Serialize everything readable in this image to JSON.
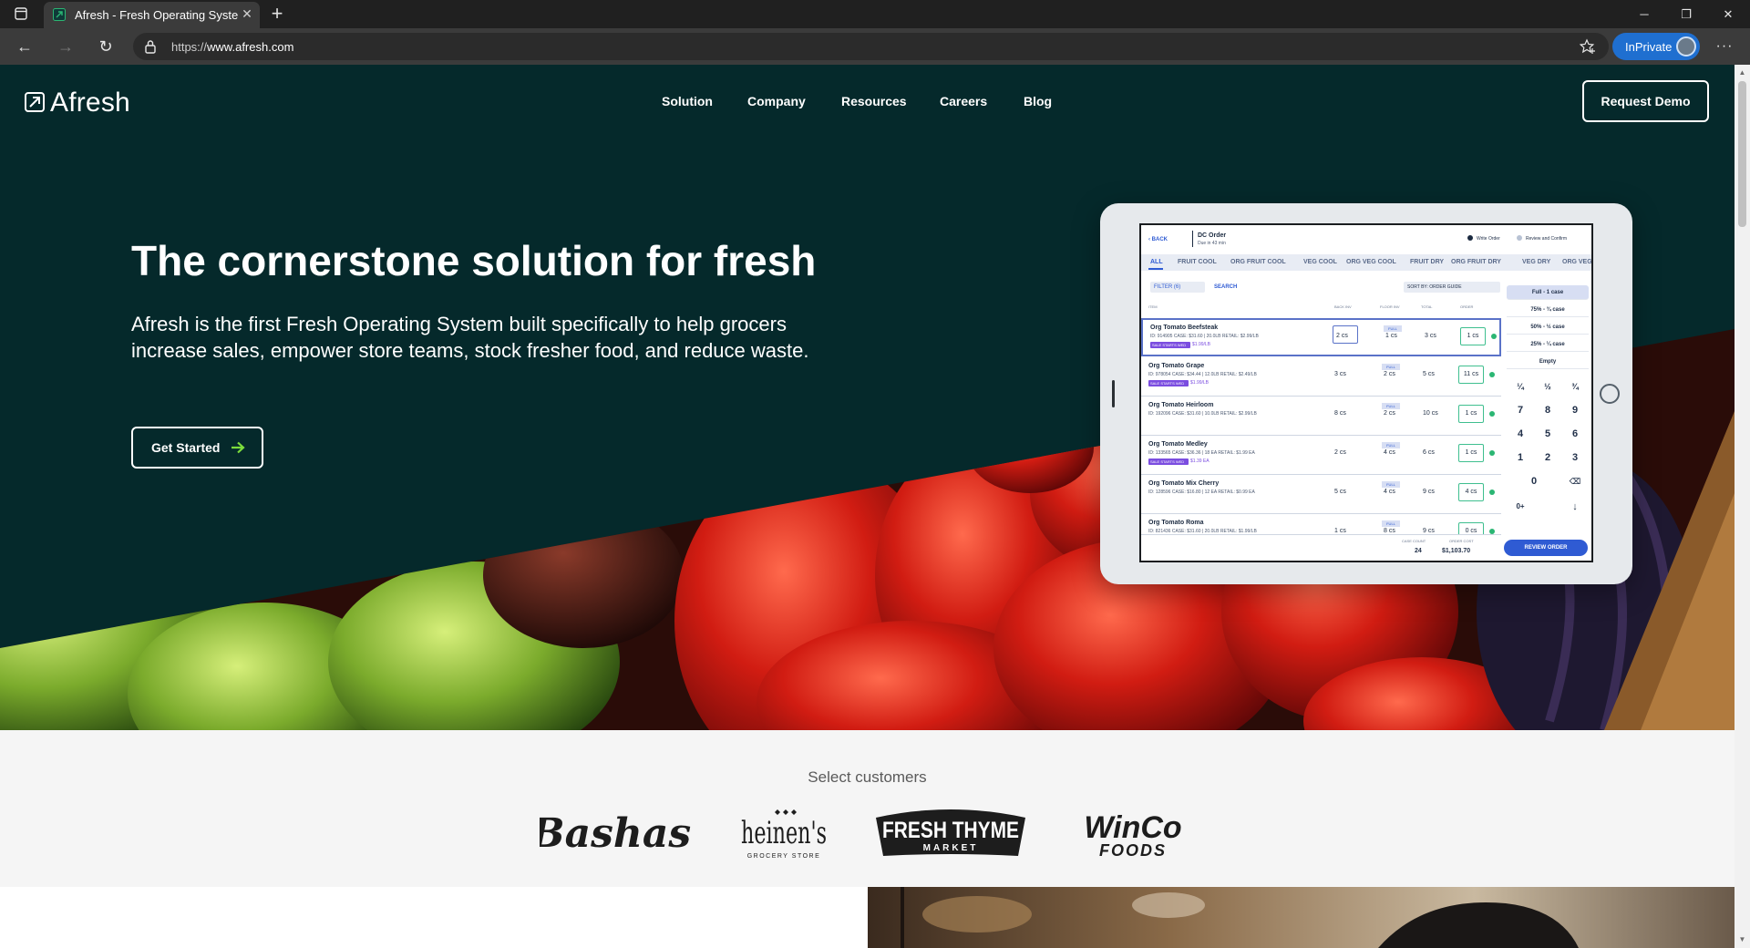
{
  "browser": {
    "tab_title": "Afresh - Fresh Operating System",
    "tab_close": "✕",
    "new_tab": "+",
    "url_scheme": "https://",
    "url_host": "www.afresh.com",
    "inprivate_label": "InPrivate",
    "menu_glyph": "···",
    "minimize": "─",
    "restore": "❐",
    "close": "✕",
    "back": "←",
    "forward": "→",
    "reload": "↻"
  },
  "site": {
    "logo_text": "Afresh",
    "nav": [
      "Solution",
      "Company",
      "Resources",
      "Careers",
      "Blog"
    ],
    "cta_label": "Request Demo"
  },
  "hero": {
    "headline": "The cornerstone solution for fresh",
    "subhead": "Afresh is the first Fresh Operating System built specifically to help grocers increase sales, empower store teams, stock fresher food, and reduce waste.",
    "button_label": "Get Started"
  },
  "tablet": {
    "back": "BACK",
    "title": "DC Order",
    "due": "Due in 43 min",
    "step1": "Write Order",
    "step2": "Review and Confirm",
    "tabs": [
      "ALL",
      "FRUIT COOL",
      "ORG FRUIT COOL",
      "VEG COOL",
      "ORG VEG COOL",
      "FRUIT DRY",
      "ORG FRUIT DRY",
      "VEG DRY",
      "ORG VEG"
    ],
    "filter": "FILTER (6)",
    "search": "SEARCH",
    "sort": "SORT BY:  ORDER GUIDE",
    "col_item": "ITEM",
    "col_back": "BACK INV",
    "col_floor": "FLOOR INV",
    "col_total": "TOTAL",
    "col_order": "ORDER",
    "full_tag": "FULL",
    "rows": [
      {
        "name": "Org Tomato Beefsteak",
        "meta": "ID: 914905    CASE: $31.60 | 20.0LB    RETAIL: $2.99/LB",
        "back": "2 cs",
        "floor": "1 cs",
        "total": "3 cs",
        "order": "1 cs",
        "tag": "SALE STARTS WED",
        "tag_price": "$1.99/LB"
      },
      {
        "name": "Org Tomato Grape",
        "meta": "ID: 978054    CASE: $34.44 | 12.0LB    RETAIL: $2.49/LB",
        "back": "3 cs",
        "floor": "2 cs",
        "total": "5 cs",
        "order": "11 cs",
        "tag": "SALE STARTS WED",
        "tag_price": "$1.99/LB"
      },
      {
        "name": "Org Tomato Heirloom",
        "meta": "ID: 192096    CASE: $31.60 | 10.0LB    RETAIL: $2.99/LB",
        "back": "8 cs",
        "floor": "2 cs",
        "total": "10 cs",
        "order": "1 cs",
        "tag": "",
        "tag_price": ""
      },
      {
        "name": "Org Tomato Medley",
        "meta": "ID: 133565    CASE: $36.36 | 18 EA    RETAIL: $1.99 EA",
        "back": "2 cs",
        "floor": "4 cs",
        "total": "6 cs",
        "order": "1 cs",
        "tag": "SALE STARTS WED",
        "tag_price": "$1.39 EA"
      },
      {
        "name": "Org Tomato Mix Cherry",
        "meta": "ID: 128596    CASE: $16.80 | 12 EA    RETAIL: $0.99 EA",
        "back": "5 cs",
        "floor": "4 cs",
        "total": "9 cs",
        "order": "4 cs",
        "tag": "",
        "tag_price": ""
      },
      {
        "name": "Org Tomato Roma",
        "meta": "ID: 821436    CASE: $31.60 | 20.0LB    RETAIL: $1.99/LB",
        "back": "1 cs",
        "floor": "8 cs",
        "total": "9 cs",
        "order": "0 cs",
        "tag": "",
        "tag_price": ""
      }
    ],
    "keypad_options": [
      "Full - 1 case",
      "75% - ¾ case",
      "50% - ½ case",
      "25% - ¼ case",
      "Empty"
    ],
    "fractions": [
      "¼",
      "½",
      "¾"
    ],
    "keys": [
      "7",
      "8",
      "9",
      "4",
      "5",
      "6",
      "1",
      "2",
      "3",
      "0",
      "⌫",
      "0+",
      "↓"
    ],
    "case_count_label": "CASE COUNT",
    "case_count": "24",
    "order_cost_label": "ORDER COST",
    "order_cost": "$1,103.70",
    "review_label": "REVIEW ORDER"
  },
  "customers": {
    "title": "Select customers",
    "logos": [
      "Bashas'",
      "heinen's",
      "GROCERY STORE",
      "FRESH THYME",
      "MARKET",
      "WinCo",
      "FOODS"
    ]
  },
  "colors": {
    "hero_bg": "#05292b",
    "accent_green": "#2bb673",
    "review_blue": "#2f5bd3",
    "inprivate_blue": "#1f6fd0"
  }
}
